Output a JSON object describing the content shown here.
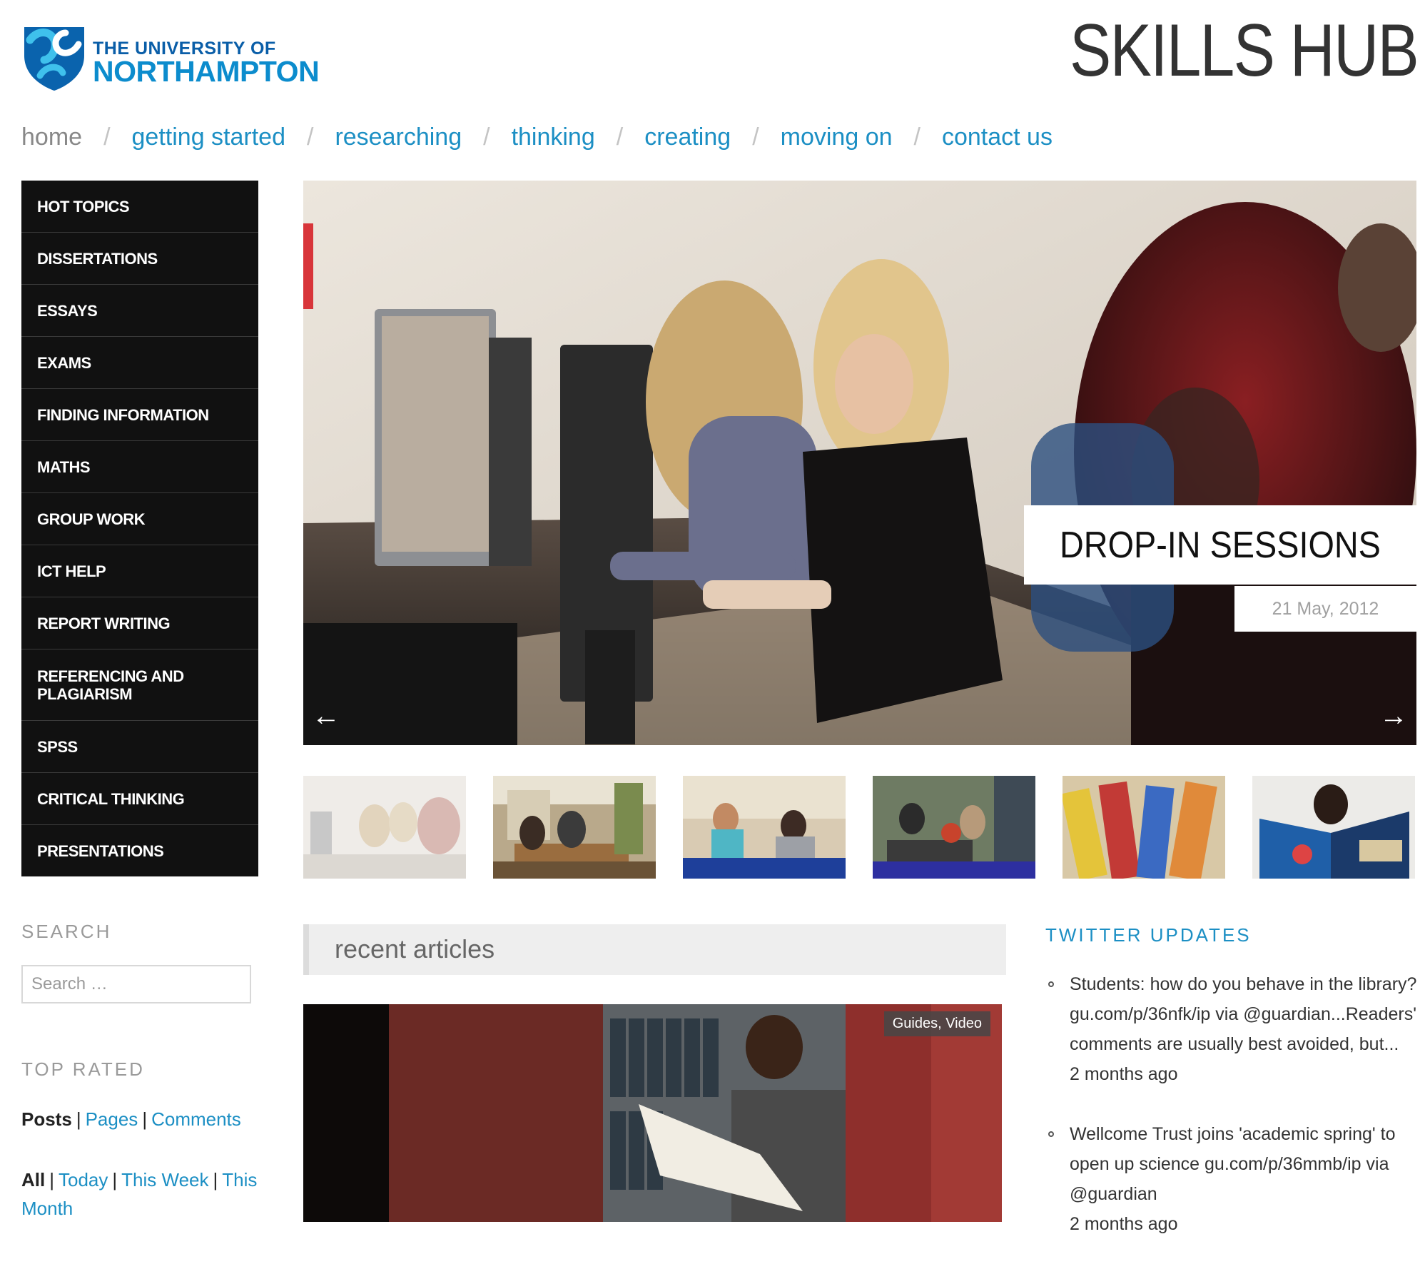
{
  "header": {
    "logo_line1": "THE UNIVERSITY OF",
    "logo_line2": "NORTHAMPTON",
    "site_title": "SKILLS HUB"
  },
  "nav": {
    "items": [
      "home",
      "getting started",
      "researching",
      "thinking",
      "creating",
      "moving on",
      "contact us"
    ],
    "current": "home",
    "separator": "/"
  },
  "sidebar_menu": [
    "HOT TOPICS",
    "DISSERTATIONS",
    "ESSAYS",
    "EXAMS",
    "FINDING INFORMATION",
    "MATHS",
    "GROUP WORK",
    "ICT HELP",
    "REPORT WRITING",
    "REFERENCING AND PLAGIARISM",
    "SPSS",
    "CRITICAL THINKING",
    "PRESENTATIONS"
  ],
  "hero": {
    "caption": "DROP-IN SESSIONS",
    "date": "21 May, 2012",
    "prev_arrow": "←",
    "next_arrow": "→"
  },
  "thumbnails_count": 6,
  "search": {
    "title": "SEARCH",
    "placeholder": "Search …"
  },
  "top_rated": {
    "title": "TOP RATED",
    "type_tabs": [
      "Posts",
      "Pages",
      "Comments"
    ],
    "type_current": "Posts",
    "period_tabs": [
      "All",
      "Today",
      "This Week",
      "This Month"
    ],
    "period_current": "All"
  },
  "recent": {
    "title": "recent articles",
    "article_tags": "Guides, Video"
  },
  "twitter": {
    "title": "TWITTER UPDATES",
    "tweets": [
      {
        "text": "Students: how do you behave in the library? gu.com/p/36nfk/ip via @guardian...Readers' comments are usually best avoided, but...",
        "ago": "2 months ago"
      },
      {
        "text": "Wellcome Trust joins 'academic spring' to open up science gu.com/p/36mmb/ip via @guardian",
        "ago": "2 months ago"
      }
    ]
  },
  "colors": {
    "link": "#1c8fc4",
    "menu_bg": "#111111",
    "logo_blue": "#0c8ccd",
    "title": "#333333"
  }
}
